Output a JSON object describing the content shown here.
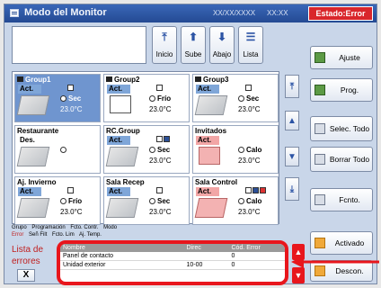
{
  "titlebar": {
    "title": "Modo del Monitor",
    "date": "XX/XX/XXXX",
    "time": "XX:XX",
    "status": "Estado:Error"
  },
  "tools": [
    {
      "label": "Inicio",
      "icon": "arrow-up-top-icon"
    },
    {
      "label": "Sube",
      "icon": "arrow-up-icon"
    },
    {
      "label": "Abajo",
      "icon": "arrow-down-icon"
    },
    {
      "label": "Lista",
      "icon": "list-icon"
    }
  ],
  "groups": [
    {
      "name": "Group1",
      "state": "Act.",
      "mode": "Sec",
      "temp": "23.0°C",
      "selected": true,
      "alarm": false
    },
    {
      "name": "Group2",
      "state": "Act.",
      "mode": "Frío",
      "temp": "23.0°C",
      "selected": false,
      "alarm": false
    },
    {
      "name": "Group3",
      "state": "Act.",
      "mode": "Sec",
      "temp": "23.0°C",
      "selected": false,
      "alarm": false
    },
    {
      "name": "Restaurante",
      "state": "Des.",
      "mode": "",
      "temp": "",
      "selected": false,
      "alarm": false
    },
    {
      "name": "RC.Group",
      "state": "Act.",
      "mode": "Sec",
      "temp": "23.0°C",
      "selected": false,
      "alarm": false
    },
    {
      "name": "Invitados",
      "state": "Act.",
      "mode": "Calo",
      "temp": "23.0°C",
      "selected": false,
      "alarm": true
    },
    {
      "name": "Aj. Invierno",
      "state": "Act.",
      "mode": "Frío",
      "temp": "23.0°C",
      "selected": false,
      "alarm": false
    },
    {
      "name": "Sala Recep",
      "state": "Act.",
      "mode": "Sec",
      "temp": "23.0°C",
      "selected": false,
      "alarm": false
    },
    {
      "name": "Sala Control",
      "state": "Act.",
      "mode": "Calo",
      "temp": "23.0°C",
      "selected": false,
      "alarm": true
    }
  ],
  "legend": {
    "line1": [
      "Grupo",
      "Programación",
      "Fcto. Contr.",
      "Modo"
    ],
    "line2": [
      "Error",
      "Señ Filt",
      "Fcto. Lim",
      "Aj. Temp."
    ]
  },
  "side_buttons": [
    {
      "label": "Ajuste",
      "icon": "settings-icon"
    },
    {
      "label": "Prog.",
      "icon": "schedule-icon"
    },
    {
      "label": "Selec. Todo",
      "icon": "select-all-icon"
    },
    {
      "label": "Borrar Todo",
      "icon": "clear-all-icon"
    },
    {
      "label": "Fcnto.",
      "icon": "operation-icon"
    },
    {
      "label": "Activado",
      "icon": "on-icon"
    },
    {
      "label": "Descon.",
      "icon": "off-icon"
    }
  ],
  "errors": {
    "title": "Lista de errores",
    "close": "X",
    "columns": [
      "Nombre",
      "Direc",
      "Cód. Error"
    ],
    "rows": [
      [
        "Panel de contacto",
        "",
        "0"
      ],
      [
        "Unidad exterior",
        "10-00",
        "0"
      ]
    ]
  },
  "colors": {
    "accent": "#244a93",
    "alarm": "#e8161c",
    "selected": "#6f95cf"
  }
}
